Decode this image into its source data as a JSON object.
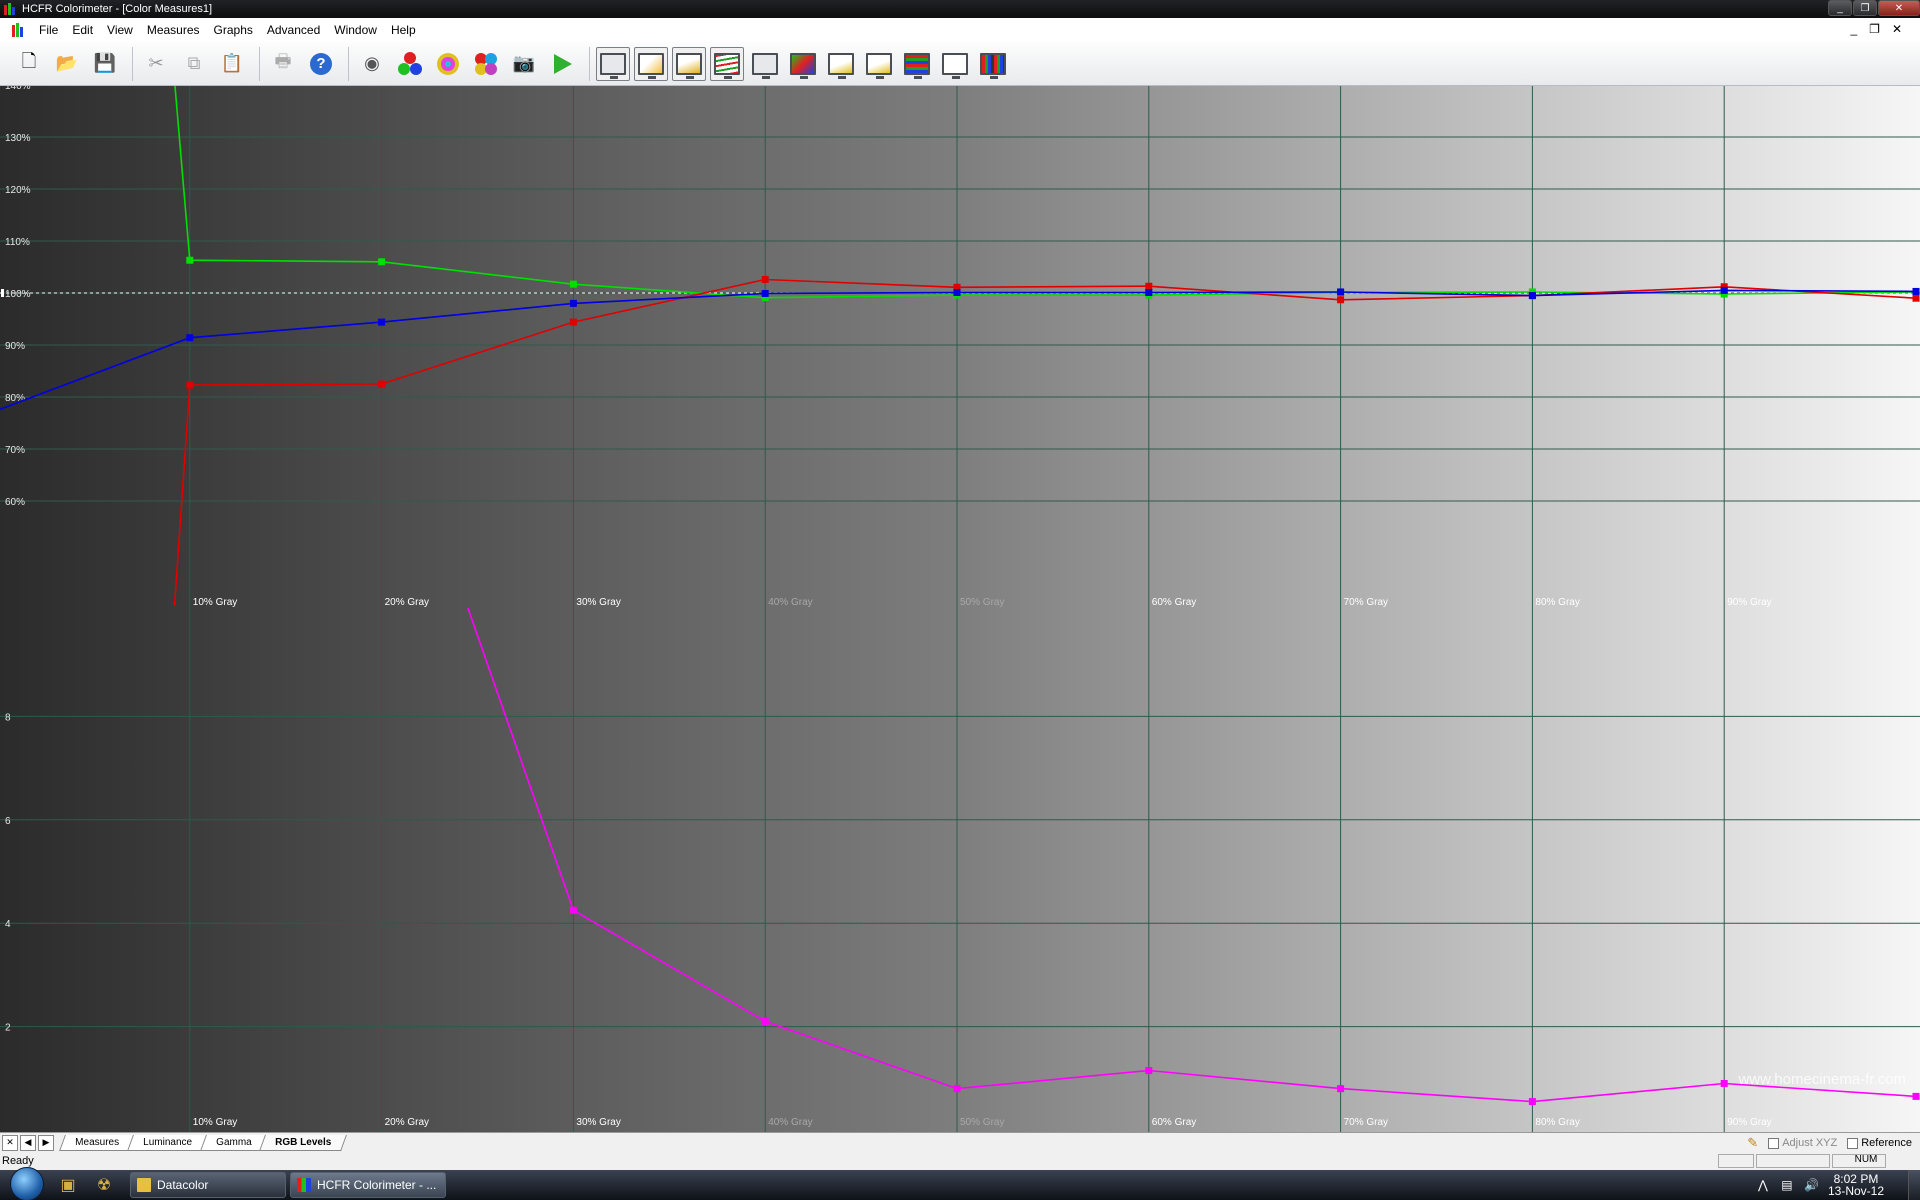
{
  "window": {
    "title": "HCFR Colorimeter - [Color Measures1]"
  },
  "menu": [
    "File",
    "Edit",
    "View",
    "Measures",
    "Graphs",
    "Advanced",
    "Window",
    "Help"
  ],
  "window_controls": {
    "minimize": "_",
    "restore": "❐",
    "close": "✕"
  },
  "toolbar": {
    "icons": [
      "new-icon",
      "open-icon",
      "save-icon",
      "cut-icon",
      "copy-icon",
      "paste-icon",
      "print-icon",
      "help-icon",
      "sensor-icon",
      "primary-colors-icon",
      "color-wheel-icon",
      "multi-color-icon",
      "camera-icon",
      "play-icon",
      "graph-measures-icon",
      "graph-luminance-icon",
      "graph-gamma-icon",
      "graph-rgb-levels-icon",
      "graph-color-temp-icon",
      "graph-cie-icon",
      "graph-lum-sat-icon",
      "graph-color-comparator-icon",
      "graph-rgb-histogram-icon",
      "graph-near-black-icon",
      "graph-near-white-icon"
    ]
  },
  "chart_data": [
    {
      "type": "line",
      "x": [
        "10% Gray",
        "20% Gray",
        "30% Gray",
        "40% Gray",
        "50% Gray",
        "60% Gray",
        "70% Gray",
        "80% Gray",
        "90% Gray"
      ],
      "y_ticks": [
        "60%",
        "70%",
        "80%",
        "90%",
        "100%",
        "110%",
        "120%",
        "130%",
        "140%"
      ],
      "series": [
        {
          "color": "#00e000",
          "values": [
            206,
            106.3,
            106,
            101.7,
            99.1,
            99.6,
            99.6,
            100.1,
            100.2,
            99.8,
            100.2
          ]
        },
        {
          "color": "#e00000",
          "values": [
            40,
            82.3,
            82.5,
            94.4,
            102.6,
            101.1,
            101.3,
            98.7,
            99.5,
            101.2,
            99.0
          ]
        },
        {
          "color": "#0000e0",
          "values": [
            77.5,
            91.4,
            94.4,
            98.0,
            99.9,
            100.1,
            100.1,
            100.2,
            99.5,
            100.5,
            100.3
          ]
        }
      ],
      "x_domain": [
        0,
        100
      ],
      "x_positions": [
        0,
        10,
        20,
        30,
        40,
        50,
        60,
        70,
        80,
        90,
        100
      ],
      "ylim": [
        50,
        150
      ]
    },
    {
      "type": "line",
      "x": [
        "10% Gray",
        "20% Gray",
        "30% Gray",
        "40% Gray",
        "50% Gray",
        "60% Gray",
        "70% Gray",
        "80% Gray",
        "90% Gray"
      ],
      "y_ticks": [
        "2",
        "4",
        "6",
        "8"
      ],
      "series": [
        {
          "color": "#ff00ff",
          "values": [
            9.85,
            4.25,
            2.1,
            0.8,
            1.15,
            0.8,
            0.55,
            0.9,
            0.65
          ]
        }
      ],
      "x_positions": [
        24.5,
        30,
        40,
        50,
        60,
        70,
        80,
        90,
        100
      ],
      "x_domain": [
        0,
        100
      ],
      "ylim": [
        0,
        10
      ]
    }
  ],
  "watermark": "www.homecinema-fr.com",
  "tabs": [
    "Measures",
    "Luminance",
    "Gamma",
    "RGB Levels"
  ],
  "active_tab": "RGB Levels",
  "tab_nav": [
    "✕",
    "◀",
    "▶"
  ],
  "options": {
    "adjust_xyz": "Adjust XYZ",
    "reference": "Reference"
  },
  "status": {
    "text": "Ready",
    "num": "NUM"
  },
  "taskbar": {
    "tasks": [
      {
        "label": "Datacolor",
        "active": false
      },
      {
        "label": "HCFR Colorimeter - ...",
        "active": true
      }
    ],
    "time": "8:02 PM",
    "date": "13-Nov-12"
  }
}
